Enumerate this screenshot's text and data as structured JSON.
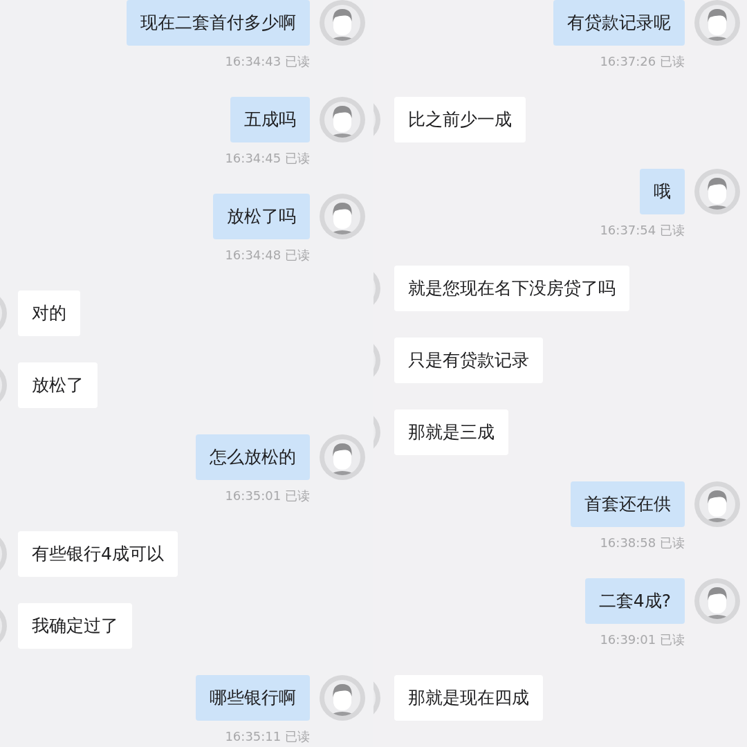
{
  "panels": [
    {
      "messages": [
        {
          "kind": "sent",
          "text": "现在二套首付多少啊",
          "timestamp": "16:34:43 已读"
        },
        {
          "kind": "sent",
          "text": "五成吗",
          "timestamp": "16:34:45 已读"
        },
        {
          "kind": "sent",
          "text": "放松了吗",
          "timestamp": "16:34:48 已读"
        },
        {
          "kind": "received",
          "text": "对的"
        },
        {
          "kind": "received",
          "text": "放松了"
        },
        {
          "kind": "sent",
          "text": "怎么放松的",
          "timestamp": "16:35:01 已读"
        },
        {
          "kind": "received",
          "text": "有些银行4成可以"
        },
        {
          "kind": "received",
          "text": "我确定过了"
        },
        {
          "kind": "sent",
          "text": "哪些银行啊",
          "timestamp": "16:35:11 已读"
        }
      ]
    },
    {
      "messages": [
        {
          "kind": "sent",
          "text": "有贷款记录呢",
          "timestamp": "16:37:26 已读"
        },
        {
          "kind": "received",
          "text": "比之前少一成"
        },
        {
          "kind": "sent",
          "text": "哦",
          "timestamp": "16:37:54 已读"
        },
        {
          "kind": "received",
          "text": "就是您现在名下没房贷了吗"
        },
        {
          "kind": "received",
          "text": "只是有贷款记录"
        },
        {
          "kind": "received",
          "text": "那就是三成"
        },
        {
          "kind": "sent",
          "text": "首套还在供",
          "timestamp": "16:38:58 已读"
        },
        {
          "kind": "sent",
          "text": "二套4成?",
          "timestamp": "16:39:01 已读"
        },
        {
          "kind": "received",
          "text": "那就是现在四成"
        }
      ]
    }
  ]
}
